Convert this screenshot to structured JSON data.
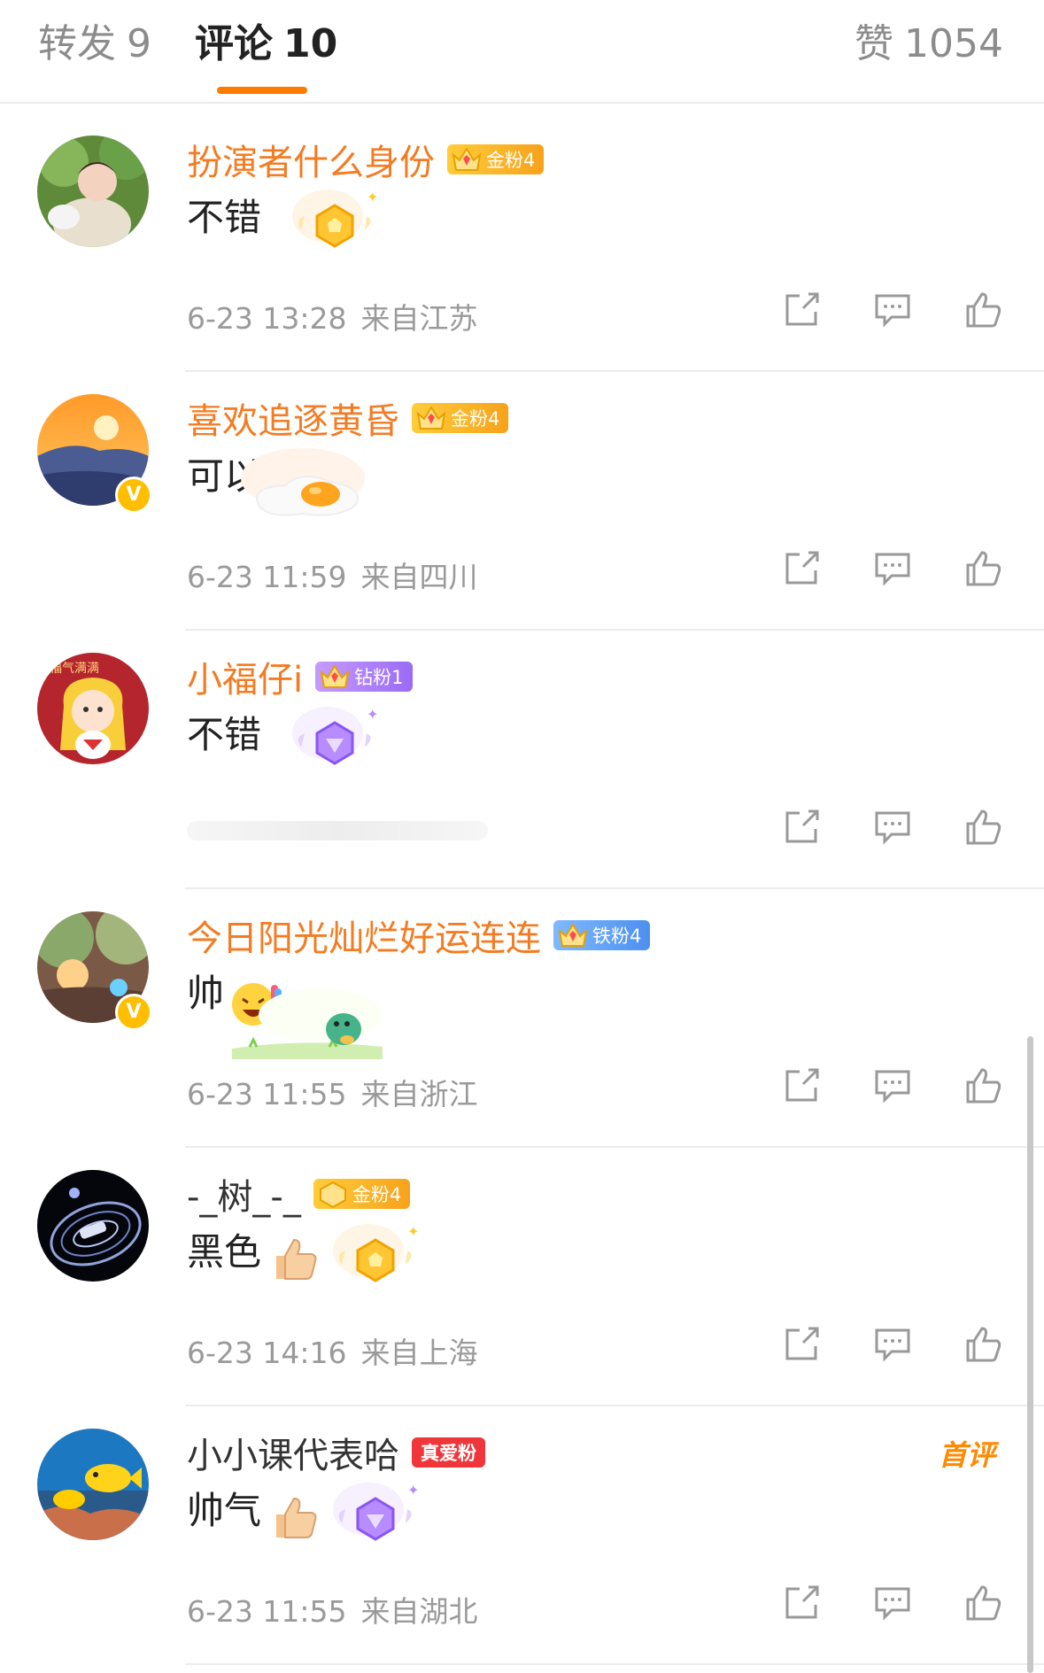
{
  "tabs": {
    "repost": {
      "label": "转发",
      "count": "9"
    },
    "comment": {
      "label": "评论",
      "count": "10"
    },
    "like": {
      "label": "赞",
      "count": "1054"
    }
  },
  "comments": [
    {
      "username": "扮演者什么身份",
      "badge": "金粉4",
      "badge_type": "gold",
      "verified": false,
      "text": "不错",
      "sticker": "gold-medal-sticker",
      "date": "6-23 13:28",
      "location": "来自江苏",
      "first": ""
    },
    {
      "username": "喜欢追逐黄昏",
      "badge": "金粉4",
      "badge_type": "gold",
      "verified": true,
      "text": "可以",
      "sticker": "fried-egg-sticker",
      "date": "6-23 11:59",
      "location": "来自四川",
      "first": ""
    },
    {
      "username": "小福仔i",
      "badge": "钻粉1",
      "badge_type": "diamond",
      "verified": false,
      "text": "不错",
      "sticker": "purple-diamond-sticker",
      "date": "",
      "location": "",
      "first": ""
    },
    {
      "username": "今日阳光灿烂好运连连",
      "badge": "铁粉4",
      "badge_type": "iron",
      "verified": true,
      "text": "帅",
      "sticker": "dinosaur-sticker",
      "date": "6-23 11:55",
      "location": "来自浙江",
      "first": ""
    },
    {
      "username": "-_树_-_",
      "badge": "金粉4",
      "badge_type": "gold",
      "verified": false,
      "text": "黑色",
      "sticker": "gold-medal-sticker",
      "date": "6-23 14:16",
      "location": "来自上海",
      "first": ""
    },
    {
      "username": "小小课代表哈",
      "badge": "真爱粉",
      "badge_type": "true-love",
      "verified": false,
      "text": "帅气",
      "sticker": "purple-diamond-sticker",
      "date": "6-23 11:55",
      "location": "来自湖北",
      "first": "首评"
    }
  ],
  "colors": {
    "accent": "#ff7a00",
    "username": "#f47b21",
    "meta": "#9a9a9a"
  }
}
